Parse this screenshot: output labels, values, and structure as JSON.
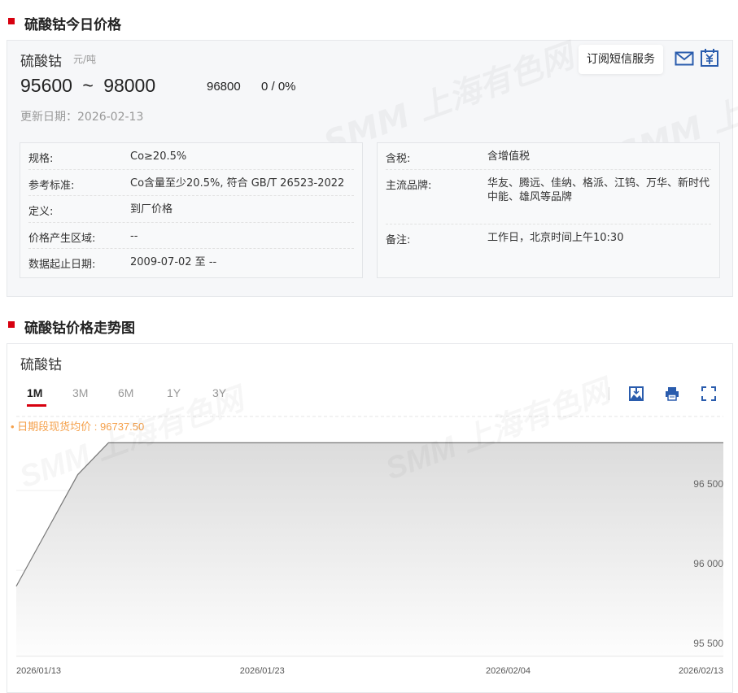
{
  "section1": {
    "title": "硫酸钴今日价格"
  },
  "product": {
    "name": "硫酸钴",
    "unit": "元/吨",
    "low": "95600",
    "tilde": "~",
    "high": "98000",
    "mid": "96800",
    "change": "0 / 0%",
    "update_label": "更新日期：",
    "update_date": "2026-02-13"
  },
  "subscribe": {
    "label": "订阅短信服务",
    "mail_icon": "mail-icon",
    "price_icon": "yen-calendar-icon"
  },
  "left_table": [
    {
      "k": "规格:",
      "v": "Co≥20.5%"
    },
    {
      "k": "参考标准:",
      "v": "Co含量至少20.5%, 符合 GB/T 26523-2022"
    },
    {
      "k": "定义:",
      "v": "到厂价格"
    },
    {
      "k": "价格产生区域:",
      "v": "--"
    },
    {
      "k": "数据起止日期:",
      "v": "2009-07-02 至 --"
    }
  ],
  "right_table": [
    {
      "k": "含税:",
      "v": "含增值税"
    },
    {
      "k": "主流品牌:",
      "v": "华友、腾远、佳纳、格派、江钨、万华、新时代中能、雄风等品牌"
    },
    {
      "k": "备注:",
      "v": "工作日，北京时间上午10:30"
    }
  ],
  "section2": {
    "title": "硫酸钴价格走势图"
  },
  "chart_panel": {
    "title": "硫酸钴",
    "tabs": [
      "1M",
      "3M",
      "6M",
      "1Y",
      "3Y"
    ],
    "active_tab": "1M",
    "avg_label": "• 日期段现货均价 : 96737.50"
  },
  "watermark": "SMM 上海有色网",
  "chart_data": {
    "type": "area",
    "title": "硫酸钴",
    "x": [
      "2026/01/13",
      "2026/01/14",
      "2026/01/15",
      "2026/01/16",
      "2026/01/19",
      "2026/01/20",
      "2026/01/21",
      "2026/01/22",
      "2026/01/23",
      "2026/01/26",
      "2026/01/27",
      "2026/01/28",
      "2026/01/29",
      "2026/01/30",
      "2026/02/02",
      "2026/02/03",
      "2026/02/04",
      "2026/02/05",
      "2026/02/06",
      "2026/02/09",
      "2026/02/10",
      "2026/02/11",
      "2026/02/12",
      "2026/02/13"
    ],
    "values": [
      95900,
      96250,
      96600,
      96800,
      96800,
      96800,
      96800,
      96800,
      96800,
      96800,
      96800,
      96800,
      96800,
      96800,
      96800,
      96800,
      96800,
      96800,
      96800,
      96800,
      96800,
      96800,
      96800,
      96800
    ],
    "x_tick_labels": [
      "2026/01/13",
      "2026/01/23",
      "2026/02/04",
      "2026/02/13"
    ],
    "x_tick_index": [
      0,
      8,
      16,
      23
    ],
    "y_ticks": [
      95500,
      96000,
      96500
    ],
    "y_tick_labels": [
      "95 500",
      "96 000",
      "96 500"
    ],
    "ylim": [
      95465,
      96965
    ],
    "grid": true,
    "line_color": "#777777",
    "xlabel": "",
    "ylabel": ""
  }
}
